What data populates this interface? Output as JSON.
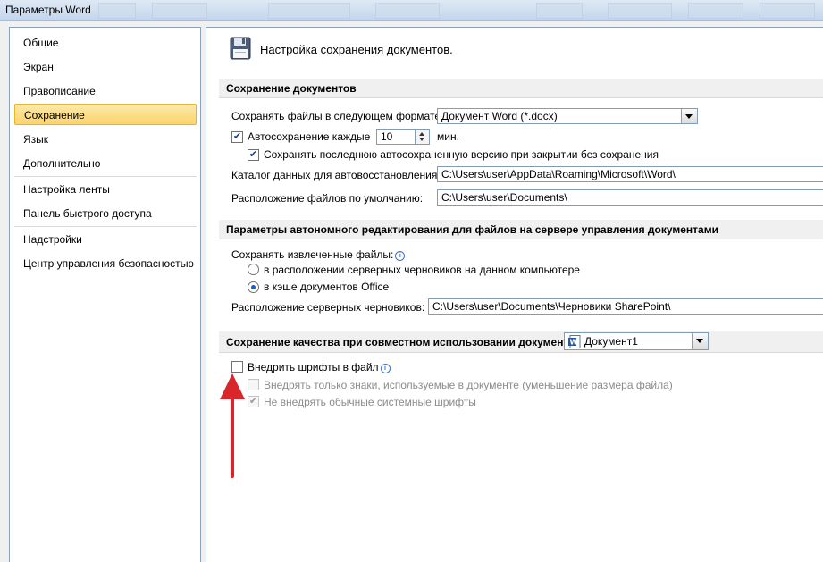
{
  "window": {
    "title": "Параметры Word"
  },
  "sidebar": {
    "items": [
      {
        "label": "Общие"
      },
      {
        "label": "Экран"
      },
      {
        "label": "Правописание"
      },
      {
        "label": "Сохранение"
      },
      {
        "label": "Язык"
      },
      {
        "label": "Дополнительно"
      },
      {
        "label": "Настройка ленты"
      },
      {
        "label": "Панель быстрого доступа"
      },
      {
        "label": "Надстройки"
      },
      {
        "label": "Центр управления безопасностью"
      }
    ],
    "active_index": 3
  },
  "main": {
    "heading": "Настройка сохранения документов.",
    "save_section": {
      "header": "Сохранение документов",
      "format_label": "Сохранять файлы в следующем формате:",
      "format_value": "Документ Word (*.docx)",
      "autosave_label": "Автосохранение каждые",
      "autosave_value": "10",
      "autosave_checked": true,
      "autosave_unit": "мин.",
      "keep_last_label": "Сохранять последнюю автосохраненную версию при закрытии без сохранения",
      "keep_last_checked": true,
      "autorecover_label": "Каталог данных для автовосстановления:",
      "autorecover_value": "C:\\Users\\user\\AppData\\Roaming\\Microsoft\\Word\\",
      "default_location_label": "Расположение файлов по умолчанию:",
      "default_location_value": "C:\\Users\\user\\Documents\\"
    },
    "offline_section": {
      "header": "Параметры автономного редактирования для файлов на сервере управления документами",
      "checked_out_label": "Сохранять извлеченные файлы:",
      "radio_server_drafts": "в расположении серверных черновиков на данном компьютере",
      "radio_office_cache": "в кэше документов Office",
      "selected_radio": "office_cache",
      "drafts_location_label": "Расположение серверных черновиков:",
      "drafts_location_value": "C:\\Users\\user\\Documents\\Черновики SharePoint\\"
    },
    "fidelity_section": {
      "header": "Сохранение качества при совместном использовании документа:",
      "document_value": "Документ1",
      "embed_fonts_label": "Внедрить шрифты в файл",
      "embed_fonts_checked": false,
      "embed_used_label": "Внедрять только знаки, используемые в документе (уменьшение размера файла)",
      "embed_used_checked": false,
      "no_common_label": "Не внедрять обычные системные шрифты",
      "no_common_checked": true
    }
  },
  "colors": {
    "active_nav": "#fbd46b",
    "annotation_arrow": "#d9262b"
  },
  "icons": {
    "heading_icon": "floppy-disk-icon",
    "info_icon": "info-icon",
    "doc_icon": "word-document-icon"
  }
}
